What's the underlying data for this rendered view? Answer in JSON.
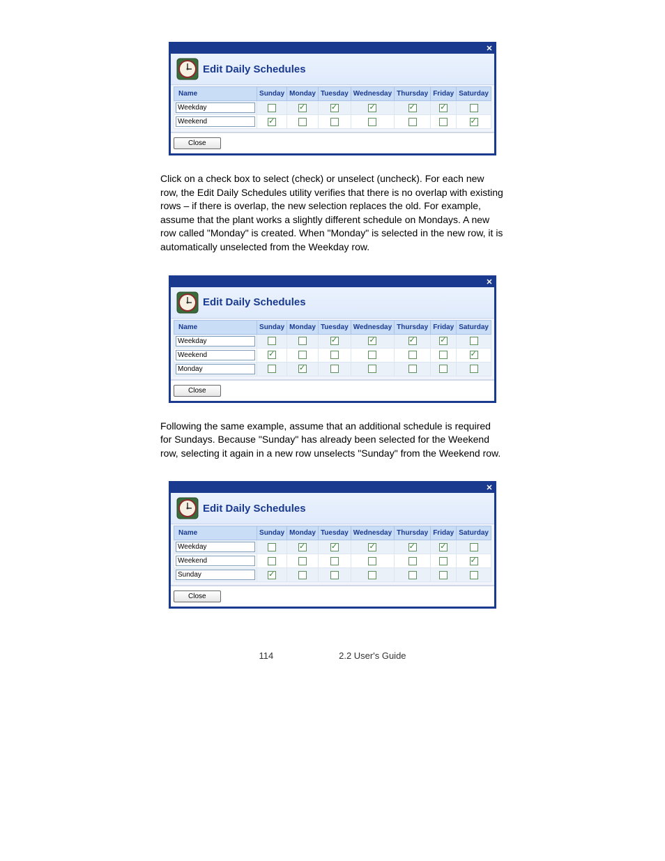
{
  "dialog_title": "Edit Daily Schedules",
  "columns": [
    "Name",
    "Sunday",
    "Monday",
    "Tuesday",
    "Wednesday",
    "Thursday",
    "Friday",
    "Saturday"
  ],
  "close_label": "Close",
  "close_x": "✕",
  "panels": [
    {
      "rows": [
        {
          "name": "Weekday",
          "alt": true,
          "days": [
            false,
            true,
            true,
            true,
            true,
            true,
            false
          ]
        },
        {
          "name": "Weekend",
          "alt": false,
          "days": [
            true,
            false,
            false,
            false,
            false,
            false,
            true
          ]
        }
      ]
    },
    {
      "rows": [
        {
          "name": "Weekday",
          "alt": true,
          "days": [
            false,
            false,
            true,
            true,
            true,
            true,
            false
          ]
        },
        {
          "name": "Weekend",
          "alt": false,
          "days": [
            true,
            false,
            false,
            false,
            false,
            false,
            true
          ]
        },
        {
          "name": "Monday",
          "alt": true,
          "days": [
            false,
            true,
            false,
            false,
            false,
            false,
            false
          ]
        }
      ]
    },
    {
      "rows": [
        {
          "name": "Weekday",
          "alt": true,
          "days": [
            false,
            true,
            true,
            true,
            true,
            true,
            false
          ]
        },
        {
          "name": "Weekend",
          "alt": false,
          "days": [
            false,
            false,
            false,
            false,
            false,
            false,
            true
          ]
        },
        {
          "name": "Sunday",
          "alt": true,
          "days": [
            true,
            false,
            false,
            false,
            false,
            false,
            false
          ]
        }
      ]
    }
  ],
  "paragraphs": {
    "p1a": "Click on a check box to select (check) or unselect (uncheck). For each new row, the Edit Daily Schedules utility verifies that there is no overlap with existing rows – if there is overlap, the new selection replaces the old. For example, assume that the plant works a slightly different schedule on Mondays. A new row called \"Monday\" is created. When \"Monday\" is selected in the new row, it is automatically unselected from the Weekday row.",
    "p2a": "Following the same example, assume that an additional schedule is required for Sundays. Because \"Sunday\" has already been selected for the Weekend row, selecting it again in a new row unselects \"Sunday\" from the Weekend row."
  },
  "footer_left": "114",
  "footer_right": "2.2 User's Guide"
}
